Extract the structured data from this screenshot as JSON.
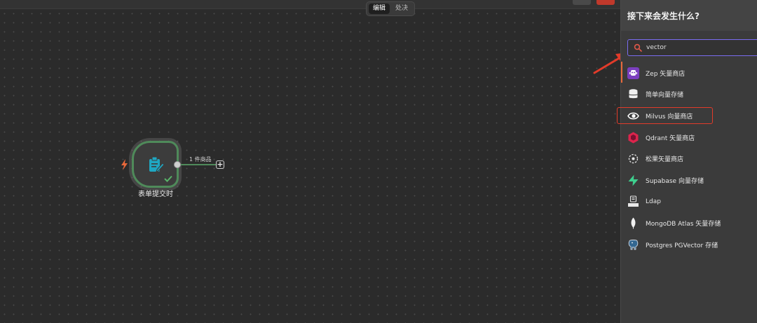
{
  "mode_switch": {
    "tabs": [
      {
        "label": "编辑",
        "active": true
      },
      {
        "label": "处决",
        "active": false
      }
    ]
  },
  "workflow": {
    "node": {
      "title": "表单提交时",
      "status": "success"
    },
    "link_label": "1 件商品",
    "add_symbol": "+"
  },
  "panel": {
    "title": "接下来会发生什么?",
    "search": {
      "value": "vector",
      "placeholder": ""
    },
    "results": [
      {
        "label": "Zep 矢量商店",
        "icon": "zep-icon"
      },
      {
        "label": "简单向量存储",
        "icon": "database-icon"
      },
      {
        "label": "Milvus 向量商店",
        "icon": "milvus-eye-icon",
        "highlighted": true
      },
      {
        "label": "Qdrant 矢量商店",
        "icon": "qdrant-icon"
      },
      {
        "label": "松果矢量商店",
        "icon": "pinecone-icon"
      },
      {
        "label": "Supabase 向量存储",
        "icon": "supabase-bolt-icon"
      },
      {
        "label": "Ldap",
        "icon": "ldap-icon"
      },
      {
        "label": "MongoDB Atlas 矢量存储",
        "icon": "mongodb-leaf-icon"
      },
      {
        "label": "Postgres PGVector 存储",
        "icon": "postgres-elephant-icon"
      }
    ]
  },
  "colors": {
    "accent": "#7a6cf0",
    "highlight_box": "#e23b2a",
    "node_success": "#4f8a5a",
    "trigger": "#e8683a"
  }
}
